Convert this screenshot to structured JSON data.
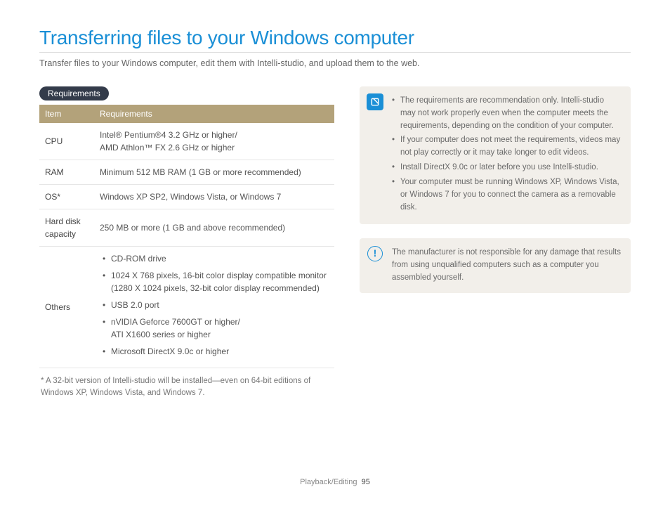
{
  "title": "Transferring files to your Windows computer",
  "intro": "Transfer files to your Windows computer, edit them with Intelli-studio, and upload them to the web.",
  "req_label": "Requirements",
  "table": {
    "head": {
      "item": "Item",
      "req": "Requirements"
    },
    "rows": {
      "cpu": {
        "label": "CPU",
        "value": "Intel® Pentium®4 3.2 GHz or higher/\nAMD Athlon™ FX 2.6 GHz or higher"
      },
      "ram": {
        "label": "RAM",
        "value": "Minimum 512 MB RAM (1 GB or more recommended)"
      },
      "os": {
        "label": "OS*",
        "value": "Windows XP SP2, Windows Vista, or Windows 7"
      },
      "hdd": {
        "label": "Hard disk capacity",
        "value": "250 MB or more (1 GB and above recommended)"
      },
      "others_label": "Others",
      "others": [
        "CD-ROM drive",
        "1024 X 768 pixels, 16-bit color display compatible monitor (1280 X 1024 pixels, 32-bit color display recommended)",
        "USB 2.0 port",
        "nVIDIA Geforce 7600GT or higher/\nATI X1600 series or higher",
        "Microsoft DirectX 9.0c or higher"
      ]
    }
  },
  "footnote": "* A 32-bit version of Intelli-studio will be installed—even on 64-bit editions of Windows XP, Windows Vista, and Windows 7.",
  "notes": [
    "The requirements are recommendation only. Intelli-studio may not work properly even when the computer meets the requirements, depending on the condition of your computer.",
    "If your computer does not meet the requirements, videos may not play correctly or it may take longer to edit videos.",
    "Install DirectX 9.0c or later before you use Intelli-studio.",
    "Your computer must be running Windows XP, Windows Vista, or Windows 7 for you to connect the camera as a removable disk."
  ],
  "warning": "The manufacturer is not responsible for any damage that results from using unqualified computers such as a computer you assembled yourself.",
  "footer": {
    "section": "Playback/Editing",
    "page": "95"
  }
}
